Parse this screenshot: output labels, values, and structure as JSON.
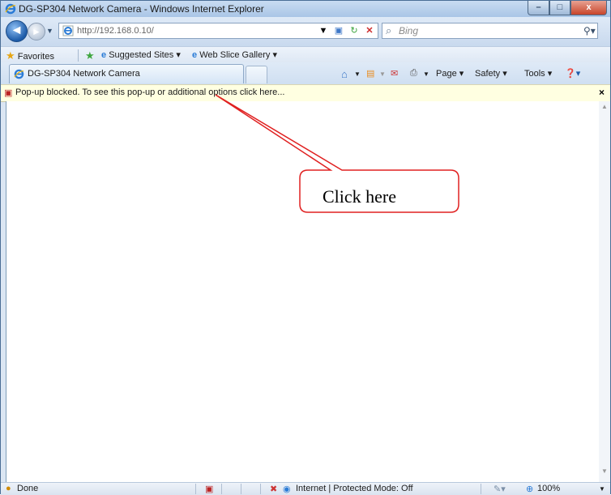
{
  "window": {
    "title": "DG-SP304 Network Camera - Windows Internet Explorer",
    "min_label": "–",
    "max_label": "□",
    "close_label": "x"
  },
  "nav": {
    "back_glyph": "◄",
    "forward_glyph": "►",
    "address": "http://192.168.0.10/",
    "search_placeholder": "Bing"
  },
  "favorites_bar": {
    "favorites_label": "Favorites",
    "items": [
      "Suggested Sites ▾",
      "Web Slice Gallery ▾"
    ]
  },
  "tab": {
    "title": "DG-SP304 Network Camera"
  },
  "command_bar": {
    "page_label": "Page ▾",
    "safety_label": "Safety ▾",
    "tools_label": "Tools ▾"
  },
  "infobar": {
    "message": "Pop-up blocked. To see this pop-up or additional options click here...",
    "close_label": "×"
  },
  "callout": {
    "label": "Click here"
  },
  "status_bar": {
    "status": "Done",
    "zone": "Internet | Protected Mode: Off",
    "zoom": "100%"
  }
}
